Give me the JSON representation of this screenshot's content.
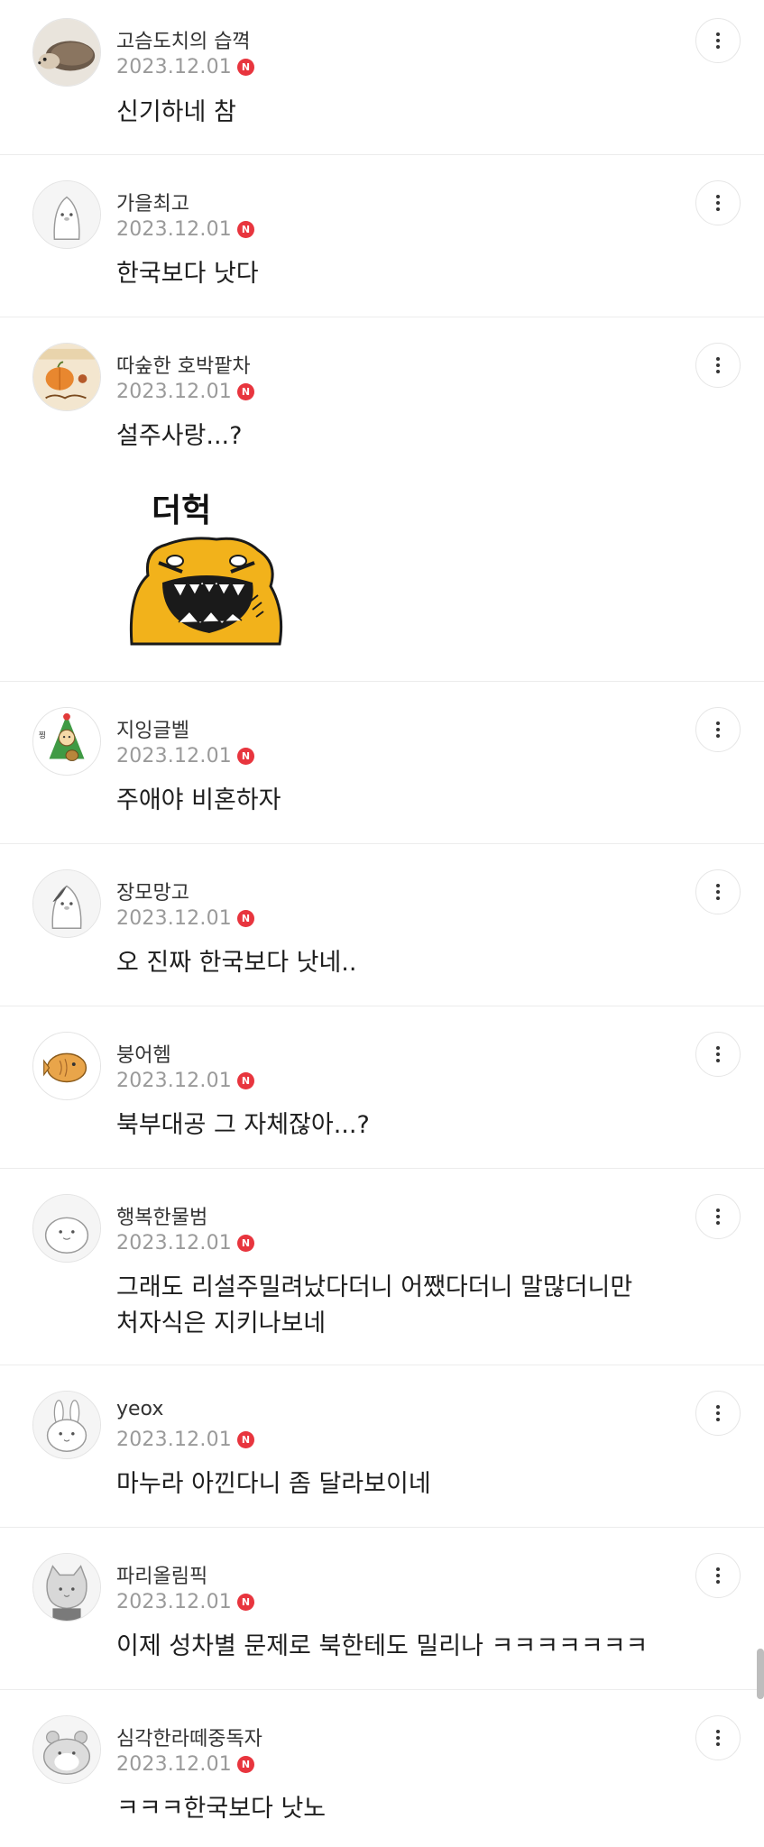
{
  "comments": [
    {
      "nickname": "고슴도치의 습껵",
      "date": "2023.12.01",
      "badge": "N",
      "text": "신기하네 참",
      "avatar": "hedgehog-photo"
    },
    {
      "nickname": "가을최고",
      "date": "2023.12.01",
      "badge": "N",
      "text": "한국보다 낫다",
      "avatar": "default-penguin"
    },
    {
      "nickname": "따숲한 호박팥차",
      "date": "2023.12.01",
      "badge": "N",
      "text": "설주사랑...?",
      "avatar": "pumpkin-tea",
      "sticker": {
        "label": "더헉",
        "name": "shocked-yellow-cat-sticker"
      }
    },
    {
      "nickname": "지잉글벨",
      "date": "2023.12.01",
      "badge": "N",
      "text": "주애야 비혼하자",
      "avatar": "christmas-tree"
    },
    {
      "nickname": "장모망고",
      "date": "2023.12.01",
      "badge": "N",
      "text": "오 진짜 한국보다 낫네..",
      "avatar": "default-penguin"
    },
    {
      "nickname": "붕어헴",
      "date": "2023.12.01",
      "badge": "N",
      "text": "북부대공 그 자체잖아...?",
      "avatar": "fish-bread"
    },
    {
      "nickname": "행복한물범",
      "date": "2023.12.01",
      "badge": "N",
      "text_lines": [
        "그래도 리설주밀려났다더니 어쨌다더니 말많더니만",
        "처자식은 지키나보네"
      ],
      "avatar": "default-seal"
    },
    {
      "nickname": "yeox",
      "date": "2023.12.01",
      "badge": "N",
      "text": "마누라 아낀다니 좀 달라보이네",
      "avatar": "default-rabbit"
    },
    {
      "nickname": "파리올림픽",
      "date": "2023.12.01",
      "badge": "N",
      "text": "이제 성차별 문제로 북한테도 밀리나 ㅋㅋㅋㅋㅋㅋㅋ",
      "avatar": "default-cat"
    },
    {
      "nickname": "심각한라떼중독자",
      "date": "2023.12.01",
      "badge": "N",
      "text": "ㅋㅋㅋ한국보다 낫노",
      "avatar": "default-hamster"
    }
  ]
}
